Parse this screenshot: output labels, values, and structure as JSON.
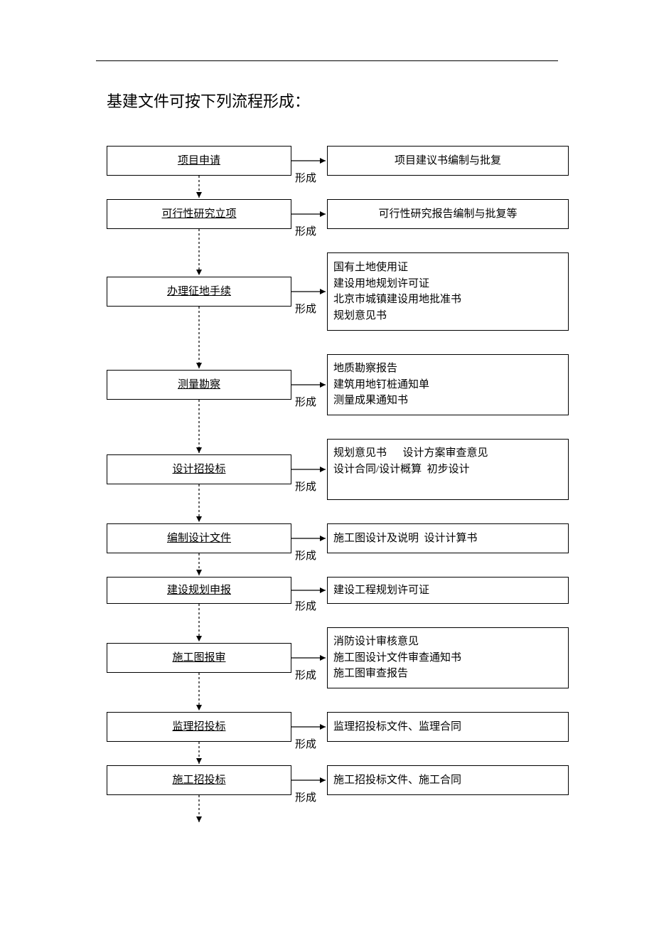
{
  "title": "基建文件可按下列流程形成：",
  "connectorLabel": "形成",
  "steps": [
    {
      "label": "项目申请",
      "outputs": [
        "项目建议书编制与批复"
      ],
      "center": true,
      "outH": 42,
      "stepH": 42
    },
    {
      "label": "可行性研究立项",
      "outputs": [
        "可行性研究报告编制与批复等"
      ],
      "center": true,
      "outH": 42,
      "stepH": 42
    },
    {
      "label": "办理征地手续",
      "outputs": [
        "国有土地使用证",
        "建设用地规划许可证",
        "北京市城镇建设用地批准书",
        "规划意见书"
      ],
      "center": false,
      "outH": 110,
      "stepH": 42
    },
    {
      "label": "测量勘察",
      "outputs": [
        "地质勘察报告",
        "建筑用地钉桩通知单",
        "测量成果通知书"
      ],
      "center": false,
      "outH": 86,
      "stepH": 42
    },
    {
      "label": "设计招投标",
      "outputs": [
        "规划意见书      设计方案审查意见",
        "设计合同/设计概算  初步设计",
        " "
      ],
      "center": false,
      "outH": 86,
      "stepH": 42
    },
    {
      "label": "编制设计文件",
      "outputs": [
        "施工图设计及说明  设计计算书"
      ],
      "center": false,
      "outH": 42,
      "stepH": 42
    },
    {
      "label": "建设规划申报",
      "outputs": [
        "建设工程规划许可证"
      ],
      "center": false,
      "outH": 38,
      "stepH": 38
    },
    {
      "label": "施工图报审",
      "outputs": [
        "消防设计审核意见",
        "施工图设计文件审查通知书",
        "施工图审查报告"
      ],
      "center": false,
      "outH": 86,
      "stepH": 42
    },
    {
      "label": "监理招投标",
      "outputs": [
        "监理招投标文件、监理合同"
      ],
      "center": false,
      "outH": 42,
      "stepH": 42
    },
    {
      "label": "施工招投标",
      "outputs": [
        "施工招投标文件、施工合同"
      ],
      "center": false,
      "outH": 42,
      "stepH": 42
    }
  ]
}
